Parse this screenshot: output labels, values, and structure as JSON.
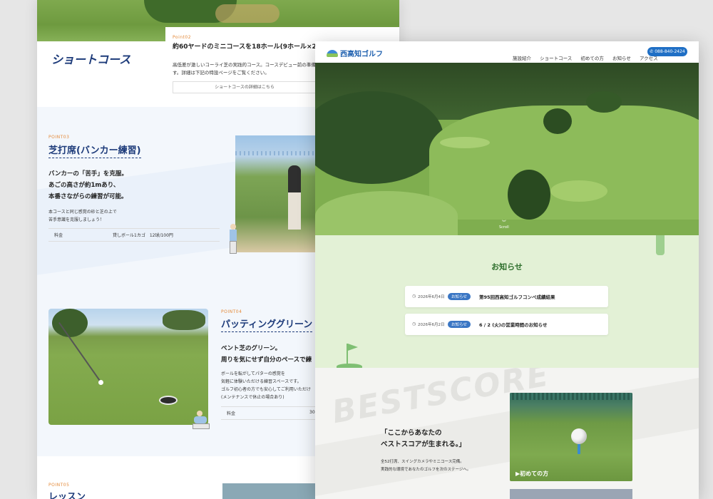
{
  "back": {
    "point02": {
      "tag": "Point02",
      "title": "約60ヤードのミニコースを18ホール(9ホール×2)",
      "desc": "高低差が激しいコーライ芝の実践的コース。コースデビュー前の準備や",
      "desc2": "す。詳細は下記の特設ページをご覧ください。",
      "link": "ショートコースの詳細はこちら"
    },
    "short_course_title": "ショートコース",
    "point03": {
      "tag": "POINT03",
      "title": "芝打席(バンカー練習)",
      "lead1": "バンカーの「苦手」を克服。",
      "lead2": "あごの高さが約1mあり、",
      "lead3": "本番さながらの練習が可能。",
      "desc1": "本コースと同じ感覚の砂と芝の上で",
      "desc2": "苦手意識を克服しましょう！",
      "price_label": "料金",
      "price_value": "貸しボール1カゴ　12球/100円"
    },
    "point04": {
      "tag": "POINT04",
      "title": "パッティンググリーン",
      "lead1": "ベント芝のグリーン。",
      "lead2": "周りを気にせず自分のペースで練",
      "desc1": "ボールを転がしてパターの感覚を",
      "desc2": "気軽に体験いただける練習スペースです。",
      "desc3": "ゴルフ初心者の方でも安心してご利用いただけ",
      "desc4": "(メンテナンスで休止の場合あり)",
      "price_label": "料金",
      "price_value": "30"
    },
    "point05": {
      "tag": "POINT05",
      "title": "レッスン"
    }
  },
  "front": {
    "logo": "西高知ゴルフ",
    "nav": [
      "施設紹介",
      "ショートコース",
      "初めての方",
      "お知らせ",
      "アクセス"
    ],
    "phone": "088-840-2424",
    "scroll": "Scroll",
    "news_title": "お知らせ",
    "news": [
      {
        "date": "2026年6月4日",
        "badge": "お知らせ",
        "title": "第95回西高知ゴルフコンペ成績結果"
      },
      {
        "date": "2026年6月2日",
        "badge": "お知らせ",
        "title": "6 / 2 (火)の営業時間のお知らせ"
      }
    ],
    "bestscore_bg": "BESTSCORE",
    "best_heading1": "「ここからあなたの",
    "best_heading2": "ベストスコアが生まれる。」",
    "best_text1": "全52打席、スイングカメラやミニコース完備。",
    "best_text2": "実践的な環境であなたのゴルフを次のステージへ。",
    "first_time_link": "▶初めての方"
  }
}
